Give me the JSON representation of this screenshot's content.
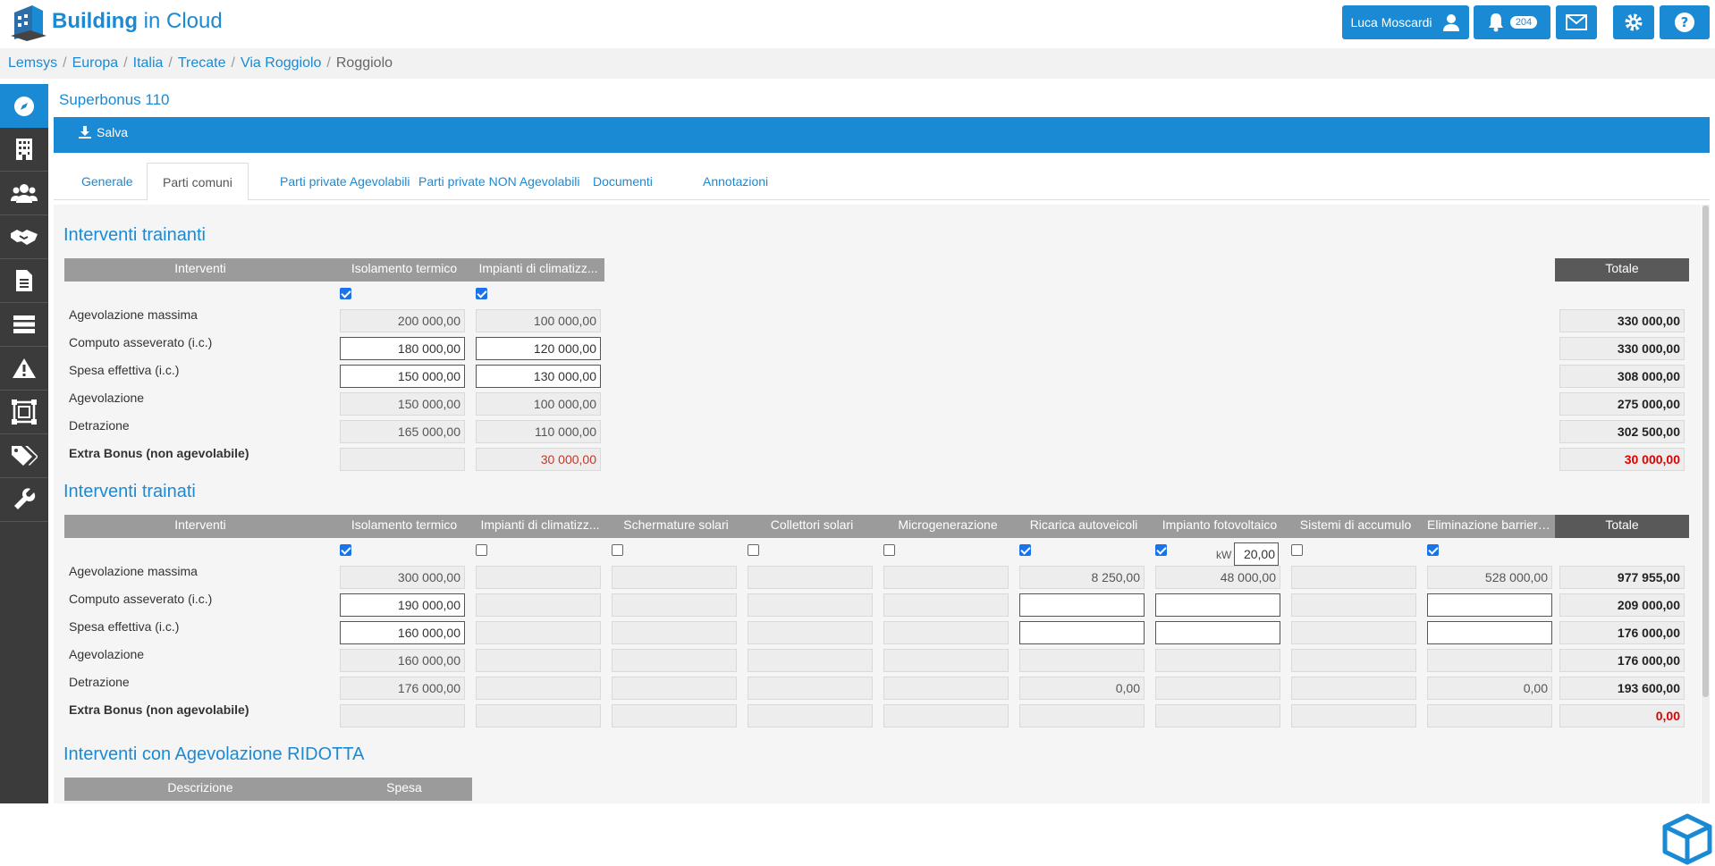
{
  "brand": {
    "name_bold": "Building",
    "name_rest": " in Cloud"
  },
  "topbar": {
    "user_name": "Luca Moscardi",
    "notifications_count": "204"
  },
  "breadcrumb": [
    "Lemsys",
    "Europa",
    "Italia",
    "Trecate",
    "Via Roggiolo",
    "Roggiolo"
  ],
  "page_title": "Superbonus 110",
  "toolbar": {
    "save_label": "Salva"
  },
  "tabs": [
    "Generale",
    "Parti comuni",
    "Parti private Agevolabili",
    "Parti private NON Agevolabili",
    "Documenti",
    "Annotazioni"
  ],
  "active_tab": "Parti comuni",
  "row_labels": [
    "Agevolazione massima",
    "Computo asseverato (i.c.)",
    "Spesa effettiva (i.c.)",
    "Agevolazione",
    "Detrazione",
    "Extra Bonus (non agevolabile)"
  ],
  "trainanti": {
    "title": "Interventi trainanti",
    "headers": [
      "Interventi",
      "Isolamento termico",
      "Impianti di climatizz...",
      "Totale"
    ],
    "checks": [
      true,
      true
    ],
    "cols": [
      [
        "200 000,00",
        "180 000,00",
        "150 000,00",
        "150 000,00",
        "165 000,00",
        ""
      ],
      [
        "100 000,00",
        "120 000,00",
        "130 000,00",
        "100 000,00",
        "110 000,00",
        "30 000,00"
      ]
    ],
    "totals": [
      "330 000,00",
      "330 000,00",
      "308 000,00",
      "275 000,00",
      "302 500,00",
      "30 000,00"
    ]
  },
  "trainati": {
    "title": "Interventi trainati",
    "headers": [
      "Interventi",
      "Isolamento termico",
      "Impianti di climatizz...",
      "Schermature solari",
      "Collettori solari",
      "Microgenerazione",
      "Ricarica autoveicoli",
      "Impianto fotovoltaico",
      "Sistemi di accumulo",
      "Eliminazione barriere...",
      "Totale"
    ],
    "checks": [
      true,
      false,
      false,
      false,
      false,
      true,
      true,
      false,
      true
    ],
    "kw_label": "kW",
    "kw_value": "20,00",
    "cols": [
      [
        "300 000,00",
        "190 000,00",
        "160 000,00",
        "160 000,00",
        "176 000,00",
        ""
      ],
      [
        "",
        "",
        "",
        "",
        "",
        ""
      ],
      [
        "",
        "",
        "",
        "",
        "",
        ""
      ],
      [
        "",
        "",
        "",
        "",
        "",
        ""
      ],
      [
        "",
        "",
        "",
        "",
        "",
        ""
      ],
      [
        "8 250,00",
        "",
        "",
        "",
        "0,00",
        ""
      ],
      [
        "48 000,00",
        "",
        "",
        "",
        "",
        ""
      ],
      [
        "",
        "",
        "",
        "",
        "",
        ""
      ],
      [
        "528 000,00",
        "",
        "",
        "",
        "0,00",
        ""
      ]
    ],
    "totals": [
      "977 955,00",
      "209 000,00",
      "176 000,00",
      "176 000,00",
      "193 600,00",
      "0,00"
    ]
  },
  "ridotta": {
    "title": "Interventi con Agevolazione RIDOTTA",
    "headers": [
      "Descrizione",
      "Spesa"
    ]
  },
  "colors": {
    "accent": "#1a8ad4",
    "sidebar": "#3b3b3b",
    "header": "#9b9b9b",
    "total_header": "#595959"
  }
}
